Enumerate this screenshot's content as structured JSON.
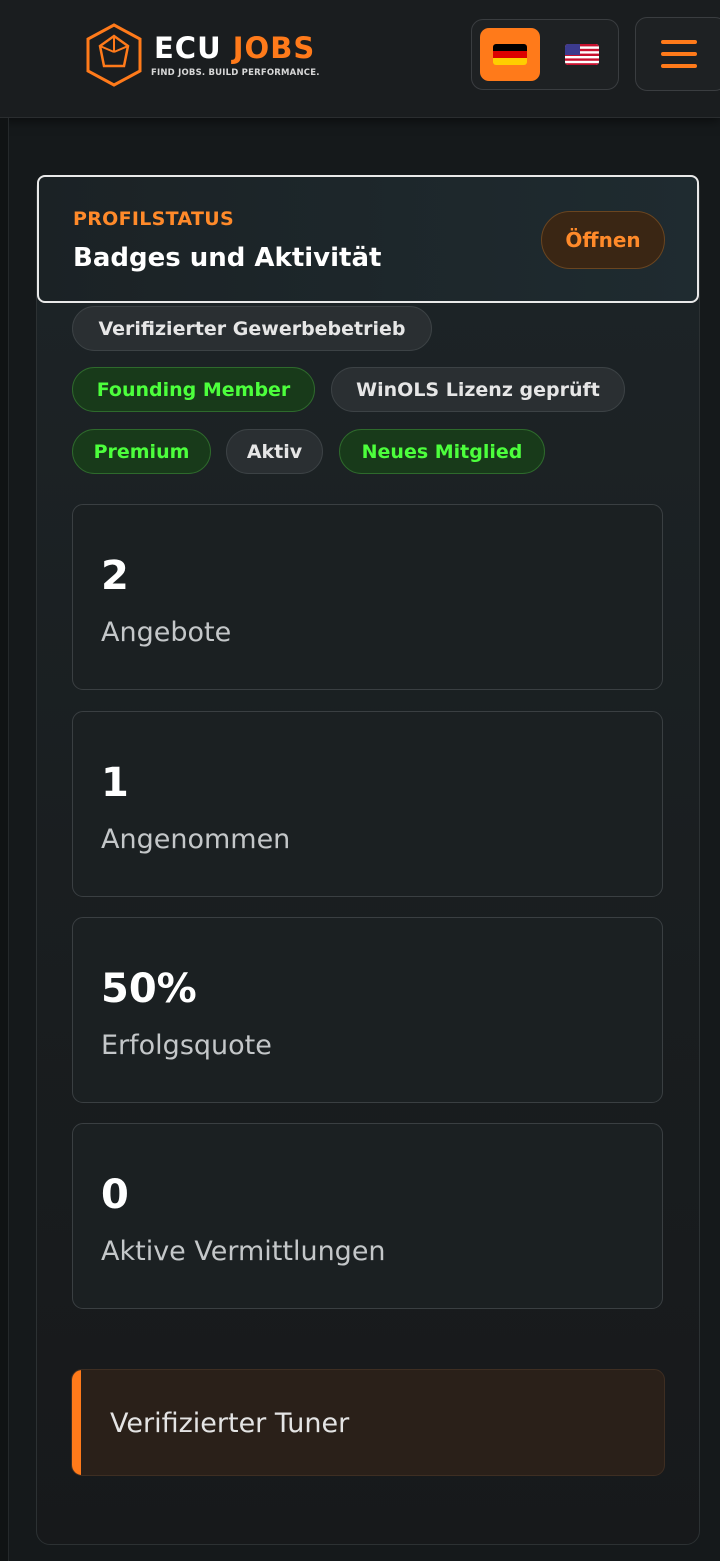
{
  "header": {
    "logo_word1": "ECU",
    "logo_word2": "JOBS",
    "logo_tagline": "FIND JOBS. BUILD PERFORMANCE.",
    "languages": [
      {
        "code": "de",
        "icon": "german-flag-icon",
        "active": true
      },
      {
        "code": "en",
        "icon": "us-flag-icon",
        "active": false
      }
    ],
    "menu_icon": "hamburger-menu-icon"
  },
  "profile_status": {
    "kicker": "PROFILSTATUS",
    "title": "Badges und Aktivität",
    "open_label": "Öffnen"
  },
  "badges": [
    {
      "label": "Verifizierter Gewerbebetrieb",
      "style": "gray"
    },
    {
      "label": "Founding Member",
      "style": "green"
    },
    {
      "label": "WinOLS Lizenz geprüft",
      "style": "gray"
    },
    {
      "label": "Premium",
      "style": "green"
    },
    {
      "label": "Aktiv",
      "style": "gray"
    },
    {
      "label": "Neues Mitglied",
      "style": "green"
    }
  ],
  "stats": [
    {
      "value": "2",
      "label": "Angebote"
    },
    {
      "value": "1",
      "label": "Angenommen"
    },
    {
      "value": "50%",
      "label": "Erfolgsquote"
    },
    {
      "value": "0",
      "label": "Aktive Vermittlungen"
    }
  ],
  "verification": {
    "label": "Verifizierter Tuner"
  },
  "colors": {
    "accent": "#ff7a1a",
    "badge_green": "#4cff3c",
    "background": "#15191b"
  }
}
